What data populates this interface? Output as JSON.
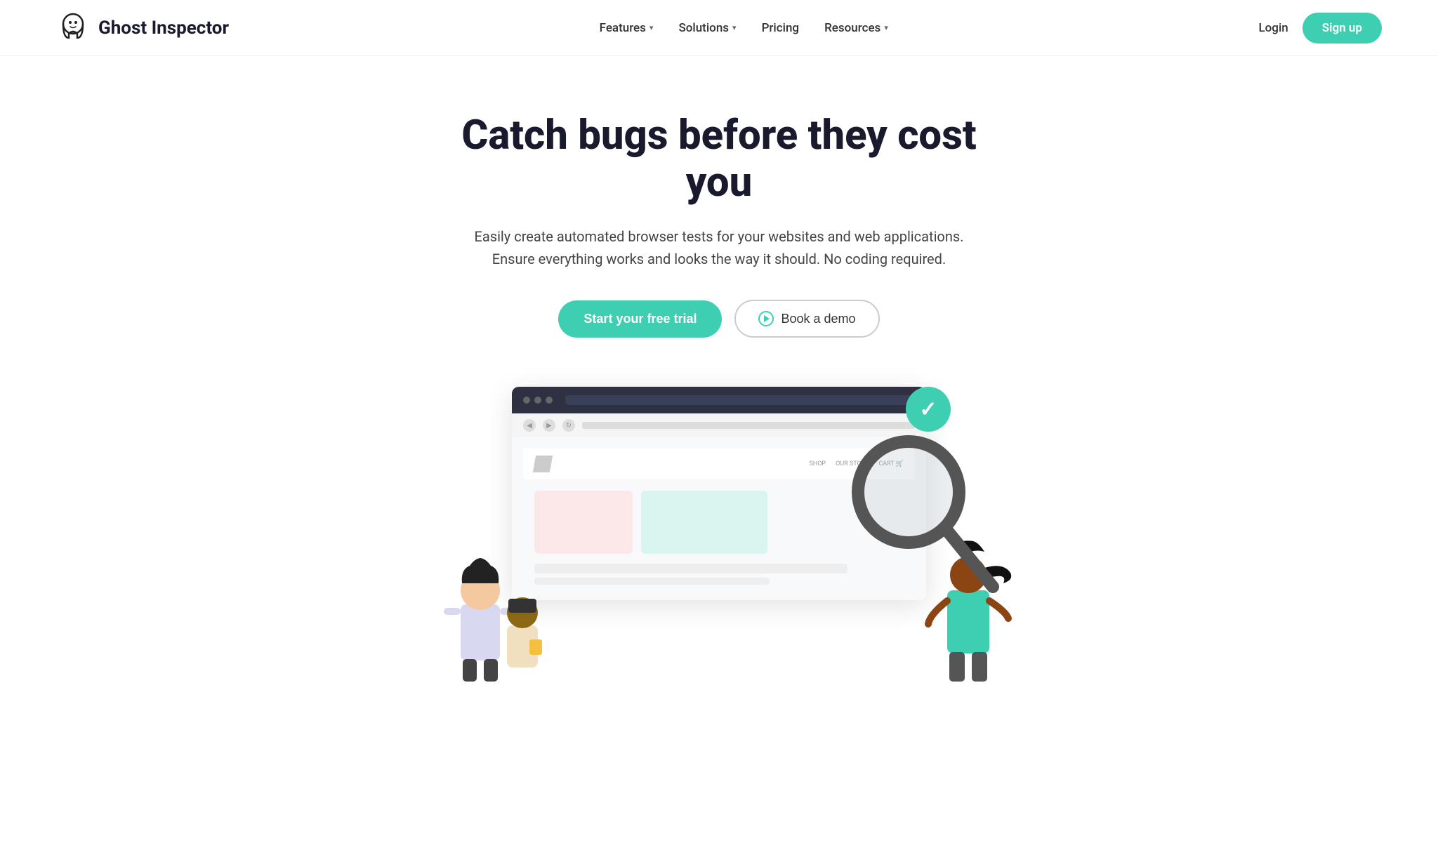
{
  "brand": {
    "name": "Ghost Inspector",
    "logo_alt": "Ghost Inspector logo"
  },
  "nav": {
    "links": [
      {
        "id": "features",
        "label": "Features",
        "has_dropdown": true
      },
      {
        "id": "solutions",
        "label": "Solutions",
        "has_dropdown": true
      },
      {
        "id": "pricing",
        "label": "Pricing",
        "has_dropdown": false
      },
      {
        "id": "resources",
        "label": "Resources",
        "has_dropdown": true
      }
    ],
    "login_label": "Login",
    "signup_label": "Sign up"
  },
  "hero": {
    "title": "Catch bugs before they cost you",
    "subtitle": "Easily create automated browser tests for your websites and web applications. Ensure everything works and looks the way it should. No coding required.",
    "cta_primary": "Start your free trial",
    "cta_secondary": "Book a demo"
  },
  "illustration": {
    "browser_nav_items": [
      "SHOP",
      "OUR STORY",
      "CART"
    ],
    "checkmark": "✓"
  },
  "colors": {
    "primary": "#3ecfb2",
    "dark": "#1a1a2e",
    "text": "#444444"
  }
}
